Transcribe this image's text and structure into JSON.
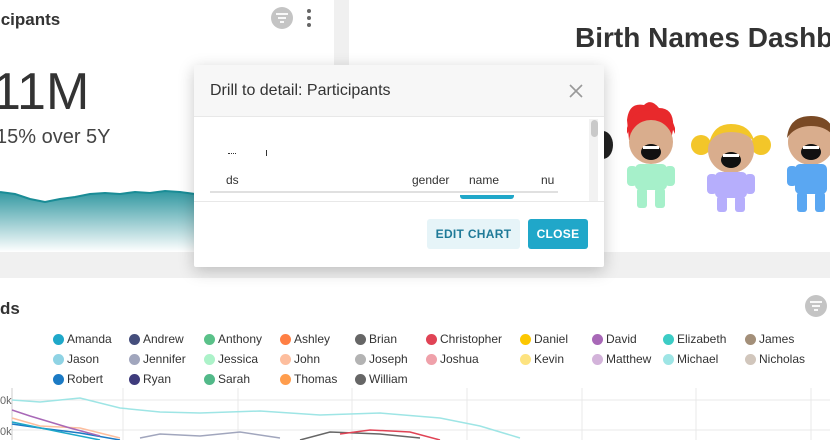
{
  "participants_card": {
    "title": "icipants",
    "big_number": "11M",
    "subheader": "15% over 5Y",
    "sparkline_color": "#1a8c96",
    "filter_icon": "filter-icon",
    "menu_icon": "more-vertical-icon"
  },
  "markdown_card": {
    "title": "Birth Names Dashb"
  },
  "trends_card": {
    "title": "ds",
    "filter_icon": "filter-icon",
    "y_axis_labels": [
      "0k",
      "0k"
    ],
    "legend": [
      {
        "name": "Amanda",
        "color": "#1fa8c9"
      },
      {
        "name": "Andrew",
        "color": "#454e7c"
      },
      {
        "name": "Anthony",
        "color": "#5ac189"
      },
      {
        "name": "Ashley",
        "color": "#ff7f44"
      },
      {
        "name": "Brian",
        "color": "#666666"
      },
      {
        "name": "Christopher",
        "color": "#e04355"
      },
      {
        "name": "Daniel",
        "color": "#fcc700"
      },
      {
        "name": "David",
        "color": "#a868b7"
      },
      {
        "name": "Elizabeth",
        "color": "#3cccc5"
      },
      {
        "name": "James",
        "color": "#a38f79"
      },
      {
        "name": "Jason",
        "color": "#8fd3e4"
      },
      {
        "name": "Jennifer",
        "color": "#a1a6bd"
      },
      {
        "name": "Jessica",
        "color": "#acf2c9"
      },
      {
        "name": "John",
        "color": "#fdbe9e"
      },
      {
        "name": "Joseph",
        "color": "#b3b3b3"
      },
      {
        "name": "Joshua",
        "color": "#efa1aa"
      },
      {
        "name": "Kevin",
        "color": "#fde380"
      },
      {
        "name": "Matthew",
        "color": "#d3b3da"
      },
      {
        "name": "Michael",
        "color": "#9ee5e5"
      },
      {
        "name": "Nicholas",
        "color": "#d1c6bc"
      },
      {
        "name": "Robert",
        "color": "#1b7ac4"
      },
      {
        "name": "Ryan",
        "color": "#3e3b7c"
      },
      {
        "name": "Sarah",
        "color": "#52b989"
      },
      {
        "name": "Thomas",
        "color": "#ff9d4d"
      },
      {
        "name": "William",
        "color": "#666666"
      }
    ]
  },
  "modal": {
    "title": "Drill to detail: Participants",
    "close_icon": "close-icon",
    "columns": [
      "ds",
      "gender",
      "name",
      "nu"
    ],
    "edit_chart_label": "EDIT CHART",
    "close_label": "CLOSE",
    "accent_color": "#20a7c9"
  }
}
